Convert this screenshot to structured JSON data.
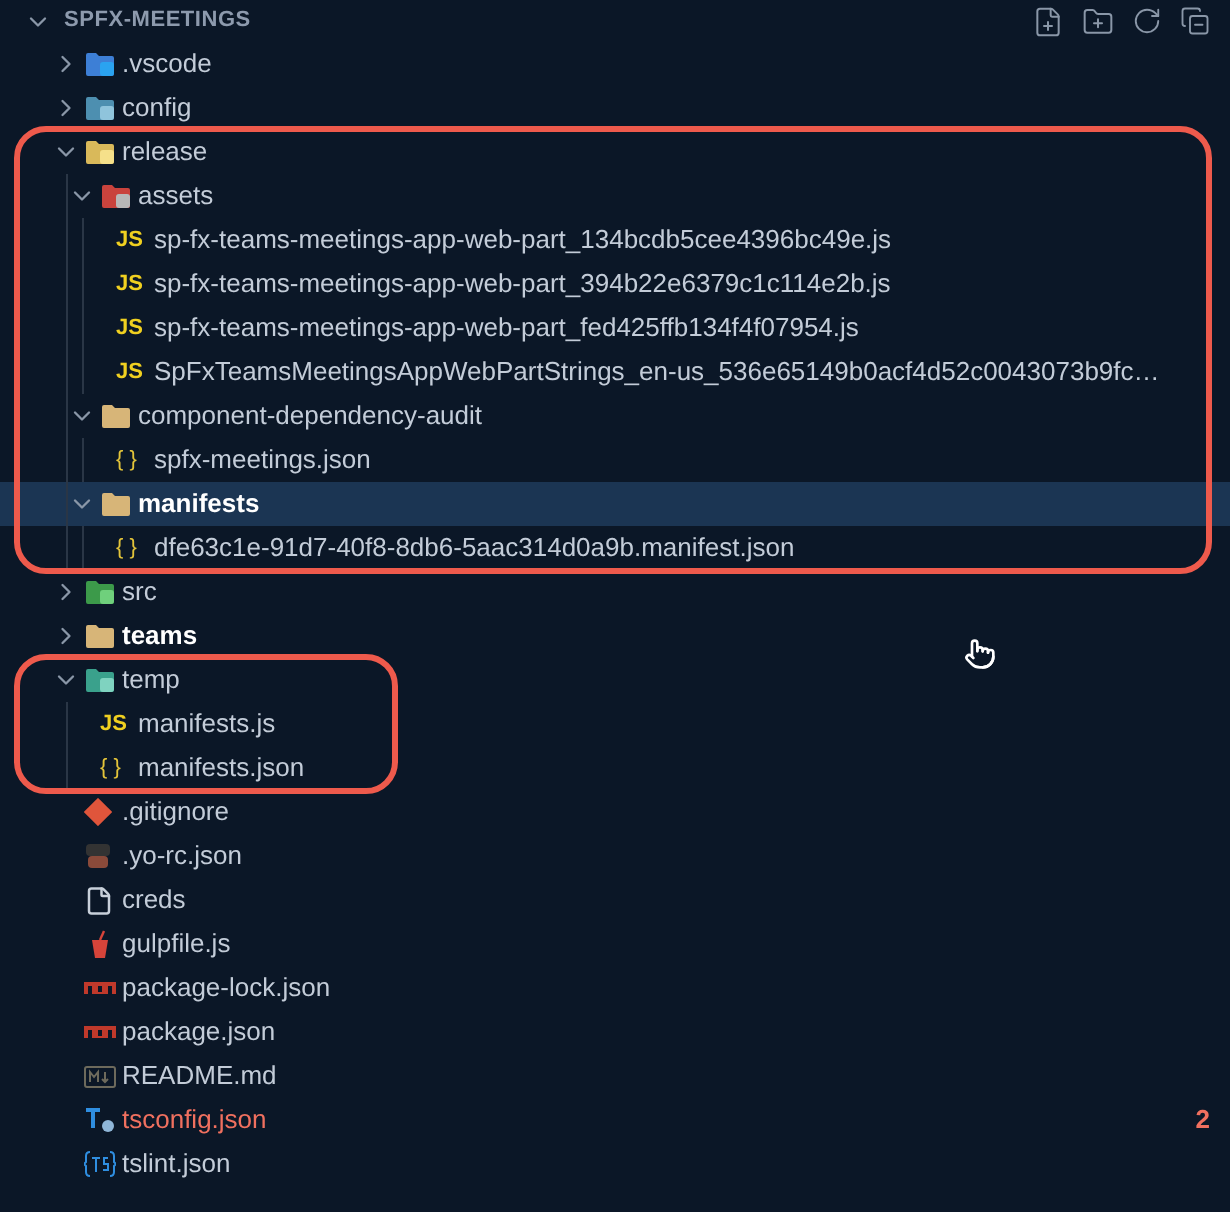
{
  "explorer": {
    "title": "SPFX-MEETINGS",
    "expanded": true
  },
  "tree": [
    {
      "name": ".vscode",
      "kind": "vscode-folder",
      "expanded": false
    },
    {
      "name": "config",
      "kind": "config-folder",
      "expanded": false
    },
    {
      "name": "release",
      "kind": "release-folder",
      "expanded": true,
      "outlined": true,
      "outline_spans_width": true,
      "children": [
        {
          "name": "assets",
          "kind": "assets-folder",
          "expanded": true,
          "children": [
            {
              "name": "sp-fx-teams-meetings-app-web-part_134bcdb5cee4396bc49e.js",
              "kind": "js",
              "icon": "JS"
            },
            {
              "name": "sp-fx-teams-meetings-app-web-part_394b22e6379c1c114e2b.js",
              "kind": "js",
              "icon": "JS"
            },
            {
              "name": "sp-fx-teams-meetings-app-web-part_fed425ffb134f4f07954.js",
              "kind": "js",
              "icon": "JS"
            },
            {
              "name": "SpFxTeamsMeetingsAppWebPartStrings_en-us_536e65149b0acf4d52c0043073b9fc…",
              "kind": "js",
              "icon": "JS"
            }
          ]
        },
        {
          "name": "component-dependency-audit",
          "kind": "folder",
          "expanded": true,
          "children": [
            {
              "name": "spfx-meetings.json",
              "kind": "json",
              "icon": "{ }"
            }
          ]
        },
        {
          "name": "manifests",
          "kind": "folder",
          "expanded": true,
          "selected": true,
          "emphasized": true,
          "children": [
            {
              "name": "dfe63c1e-91d7-40f8-8db6-5aac314d0a9b.manifest.json",
              "kind": "json",
              "icon": "{ }"
            }
          ]
        }
      ]
    },
    {
      "name": "src",
      "kind": "src-folder",
      "expanded": false
    },
    {
      "name": "teams",
      "kind": "folder",
      "expanded": false,
      "emphasized": true
    },
    {
      "name": "temp",
      "kind": "temp-folder",
      "expanded": true,
      "outlined": true,
      "outline_spans_width": false,
      "children": [
        {
          "name": "manifests.js",
          "kind": "js",
          "icon": "JS"
        },
        {
          "name": "manifests.json",
          "kind": "json",
          "icon": "{ }"
        }
      ]
    },
    {
      "name": ".gitignore",
      "kind": "git"
    },
    {
      "name": ".yo-rc.json",
      "kind": "yo"
    },
    {
      "name": "creds",
      "kind": "file"
    },
    {
      "name": "gulpfile.js",
      "kind": "gulp"
    },
    {
      "name": "package-lock.json",
      "kind": "npm"
    },
    {
      "name": "package.json",
      "kind": "npm"
    },
    {
      "name": "README.md",
      "kind": "markdown"
    },
    {
      "name": "tsconfig.json",
      "kind": "ts",
      "problem": true,
      "badge": "2"
    },
    {
      "name": "tslint.json",
      "kind": "tslint"
    }
  ]
}
